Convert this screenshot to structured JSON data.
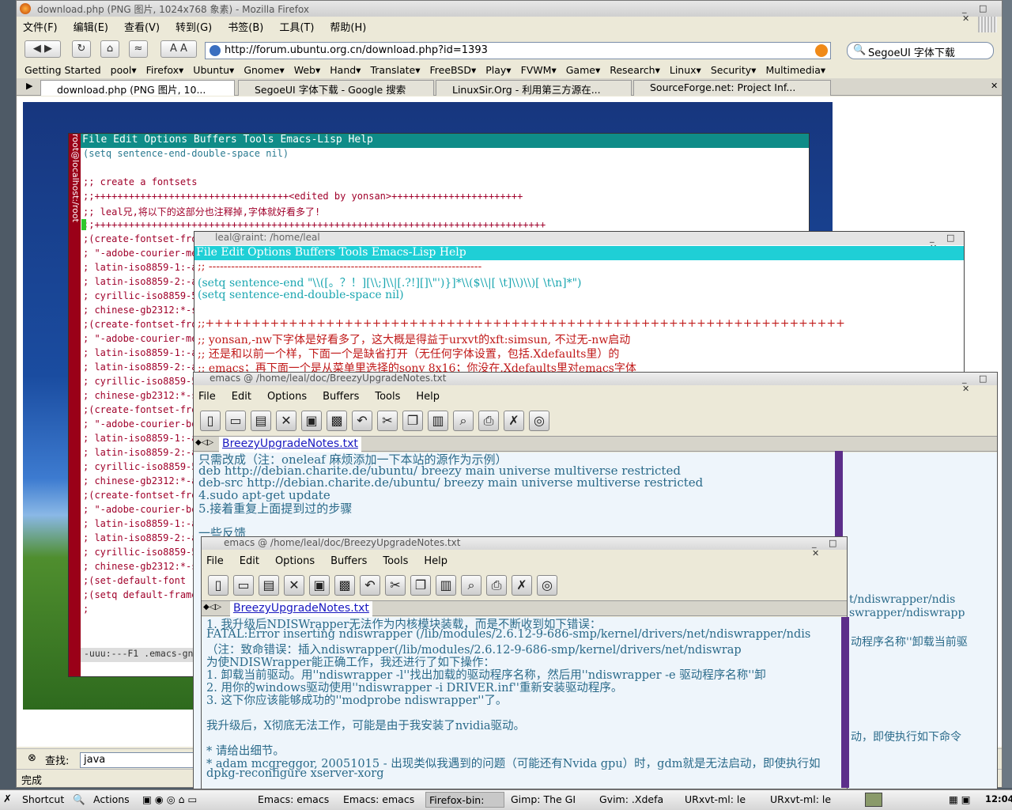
{
  "firefox": {
    "title": "download.php (PNG 图片, 1024x768 象素) - Mozilla Firefox",
    "menu": [
      "文件(F)",
      "编辑(E)",
      "查看(V)",
      "转到(G)",
      "书签(B)",
      "工具(T)",
      "帮助(H)"
    ],
    "url": "http://forum.ubuntu.org.cn/download.php?id=1393",
    "search_value": "SegoeUI 字体下载",
    "bookmarks": [
      "Getting Started",
      "pool▾",
      "Firefox▾",
      "Ubuntu▾",
      "Gnome▾",
      "Web▾",
      "Hand▾",
      "Translate▾",
      "FreeBSD▾",
      "Play▾",
      "FVWM▾",
      "Game▾",
      "Research▾",
      "Linux▾",
      "Security▾",
      "Multimedia▾"
    ],
    "tabs": [
      "download.php (PNG 图片, 10...",
      "SegoeUI 字体下载 - Google 搜索",
      "LinuxSir.Org - 利用第三方源在...",
      "SourceForge.net: Project Inf..."
    ],
    "find_label": "查找:",
    "find_value": "java",
    "status": "完成"
  },
  "emacs1": {
    "side_label": "root@localhost:/root",
    "menu": "File Edit Options Buffers Tools Emacs-Lisp Help",
    "lines": [
      "(setq sentence-end-double-space nil)",
      "",
      ";; create a fontsets",
      ";;++++++++++++++++++++++++++++++++++<edited by yonsan>+++++++++++++++++++++++",
      ";; leal兄,将以下的这部分也注释掉,字体就好看多了!",
      ";;+++++++++++++++++++++++++++++++++++++++++++++++++++++++++++++++++++++++++++++++",
      ";(create-fontset-from-fo",
      ";  \"-adobe-courier-medium",
      ";   latin-iso8859-1:-adob",
      ";   latin-iso8859-2:-adob",
      ";   cyrillic-iso8859-5:-a",
      ";   chinese-gb2312:*-song",
      ";(create-fontset-from-fo",
      ";  \"-adobe-courier-medium",
      ";   latin-iso8859-1:-adob",
      ";   latin-iso8859-2:-adob",
      ";   cyrillic-iso8859-5:-",
      ";   chinese-gb2312:*-son",
      ";(create-fontset-from-f",
      ";  \"-adobe-courier-bold-",
      ";   latin-iso8859-1:-ado",
      ";   latin-iso8859-2:-ado",
      ";   cyrillic-iso8859-5:-",
      ";   chinese-gb2312:*-ar",
      ";(create-fontset-from-f",
      ";  \"-adobe-courier-bold-",
      ";   latin-iso8859-1:-adol",
      ";   latin-iso8859-2:-adol",
      ";   cyrillic-iso8859-5:-",
      ";   chinese-gb2312:*-son",
      ";(set-default-font \"fon",
      ";(setq default-frame-al",
      ";"
    ],
    "mode_line": "-uuu:---F1   .emacs-gnu-"
  },
  "urxvt": {
    "title": "leal@raint: /home/leal",
    "menu": "File Edit Options Buffers Tools Emacs-Lisp Help",
    "lines": [
      ";; -------------------------------------------------------------------------",
      "(setq sentence-end \"\\\\([。？！][\\\\;]\\\\|[.?!][]\\\"')}]*\\\\($\\\\|[ \\t]\\\\)\\\\)[ \\t\\n]*\")",
      "(setq sentence-end-double-space nil)",
      "",
      ";;+++++++++++++++++++++++++++++++++++++++++++++++++++++++++++++++++++++",
      ";; yonsan,-nw下字体是好看多了，这大概是得益于urxvt的xft:simsun, 不过无-nw启动",
      ";; 还是和以前一个样，下面一个是缺省打开（无任何字体设置，包括.Xdefaults里）的",
      ";; emacs；再下面一个是从菜单里选择的sony 8x16；你没在.Xdefaults里对emacs字体"
    ]
  },
  "emacs3": {
    "title": "emacs @ /home/leal/doc/BreezyUpgradeNotes.txt",
    "menu": [
      "File",
      "Edit",
      "Options",
      "Buffers",
      "Tools",
      "Help"
    ],
    "tab": "BreezyUpgradeNotes.txt",
    "lines": [
      "只需改成（注：oneleaf 麻烦添加一下本站的源作为示例）",
      "deb http://debian.charite.de/ubuntu/ breezy main universe multiverse restricted",
      "deb-src http://debian.charite.de/ubuntu/ breezy main universe multiverse restricted",
      "4.sudo apt-get update",
      "5.接着重复上面提到过的步骤",
      "",
      "一些反馈"
    ],
    "right_fragments": [
      "t/ndiswrapper/ndis",
      "swrapper/ndiswrapp",
      "动程序名称''卸载当前驱",
      "动，即使执行如下命令"
    ]
  },
  "emacs4": {
    "title": "emacs @ /home/leal/doc/BreezyUpgradeNotes.txt",
    "menu": [
      "File",
      "Edit",
      "Options",
      "Buffers",
      "Tools",
      "Help"
    ],
    "tab": "BreezyUpgradeNotes.txt",
    "lines": [
      "1. 我升级后NDISWrapper无法作为内核模块装载，而是不断收到如下错误：",
      "FATAL:Error inserting ndiswrapper (/lib/modules/2.6.12-9-686-smp/kernel/drivers/net/ndiswrapper/ndis",
      "（注：致命错误：插入ndiswrapper(/lib/modules/2.6.12-9-686-smp/kernel/drivers/net/ndiswrap",
      "为使NDISWrapper能正确工作，我还进行了如下操作：",
      "1. 卸载当前驱动。用''ndiswrapper -l''找出加载的驱动程序名称，然后用''ndiswrapper -e 驱动程序名称''卸",
      "2. 用你的windows驱动使用''ndiswrapper -i DRIVER.inf''重新安装驱动程序。",
      "3. 这下你应该能够成功的''modprobe ndiswrapper''了。",
      "",
      "我升级后，X彻底无法工作，可能是由于我安装了nvidia驱动。",
      "",
      "* 请给出细节。",
      "* adam mcgreggor, 20051015 - 出现类似我遇到的问题（可能还有Nvida gpu）时，gdm就是无法启动，即使执行如",
      "dpkg-reconfigure xserver-xorg"
    ]
  },
  "taskbar": {
    "shortcut": "Shortcut",
    "actions": "Actions",
    "tasks": [
      "Emacs: emacs",
      "Emacs: emacs",
      "Firefox-bin:",
      "Gimp: The GI",
      "Gvim: .Xdefa",
      "URxvt-ml: le",
      "URxvt-ml: le"
    ],
    "clock": "12:04"
  }
}
